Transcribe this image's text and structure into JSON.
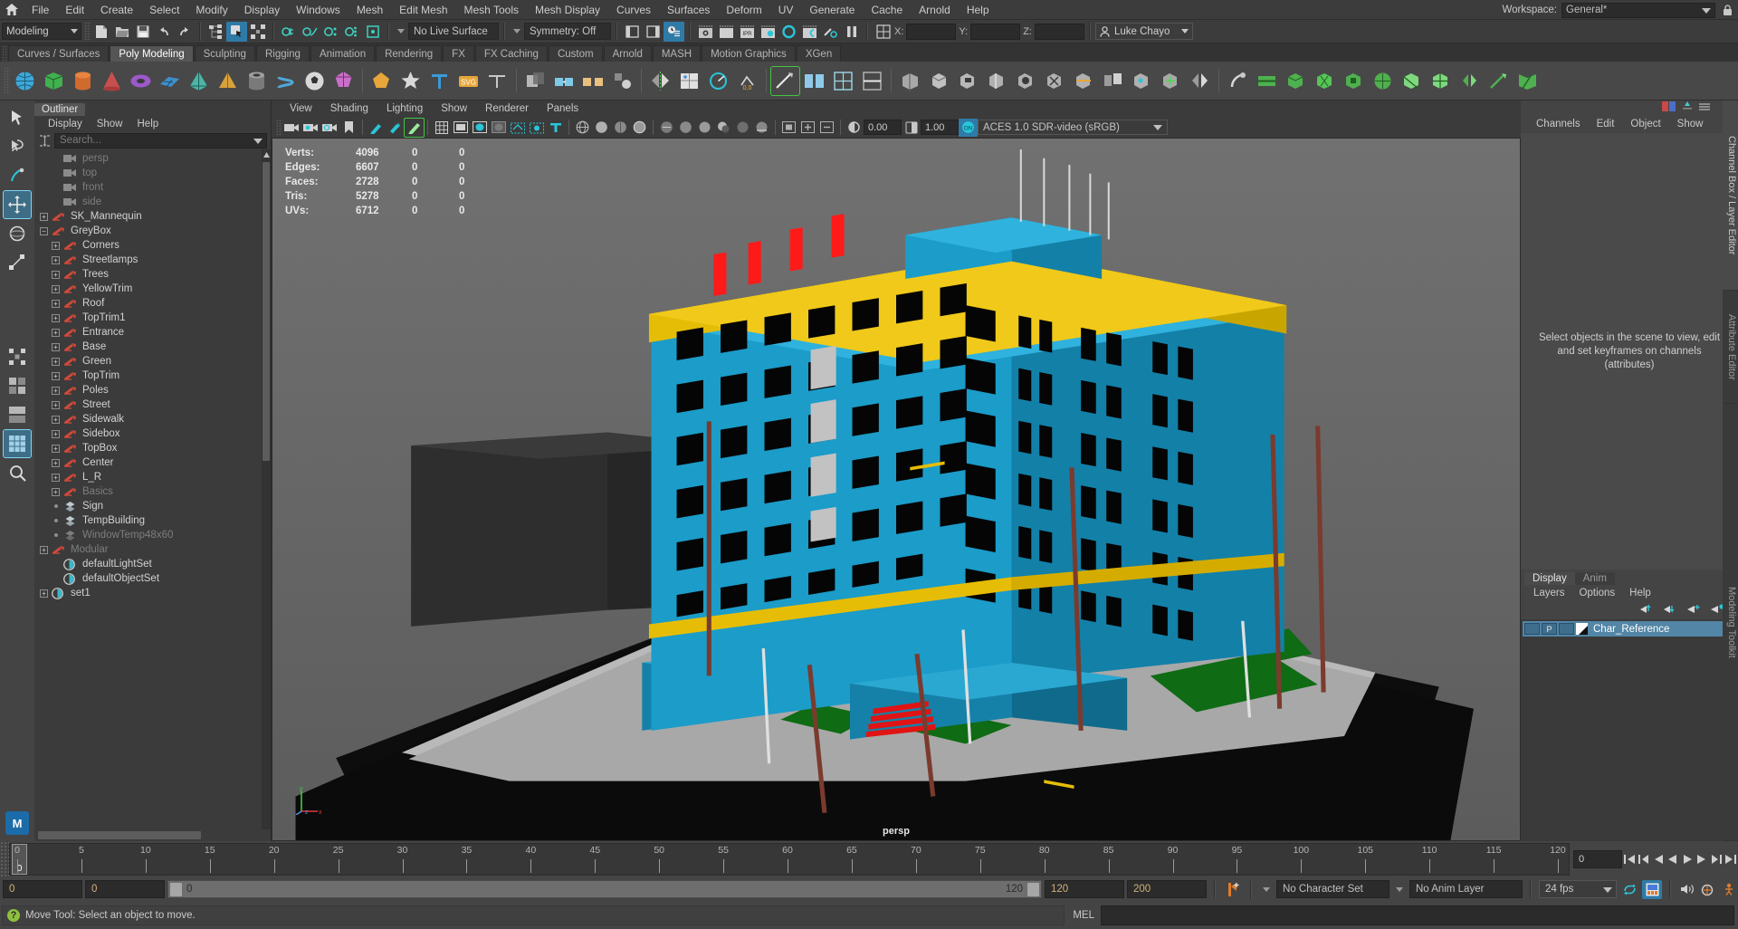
{
  "menubar": {
    "home_icon": "home-icon",
    "items": [
      "File",
      "Edit",
      "Create",
      "Select",
      "Modify",
      "Display",
      "Windows",
      "Mesh",
      "Edit Mesh",
      "Mesh Tools",
      "Mesh Display",
      "Curves",
      "Surfaces",
      "Deform",
      "UV",
      "Generate",
      "Cache",
      "Arnold",
      "Help"
    ],
    "workspace_label": "Workspace:",
    "workspace_value": "General*",
    "lock_icon": "lock-icon"
  },
  "statusline": {
    "mode": "Modeling",
    "live_surface": "No Live Surface",
    "symmetry": "Symmetry: Off",
    "coord_labels": [
      "X:",
      "Y:",
      "Z:"
    ],
    "coord_values": [
      "",
      "",
      ""
    ],
    "user": "Luke Chayo",
    "user_icon": "person-icon"
  },
  "shelf": {
    "tabs": [
      {
        "label": "Curves / Surfaces",
        "active": false
      },
      {
        "label": "Poly Modeling",
        "active": true
      },
      {
        "label": "Sculpting",
        "active": false
      },
      {
        "label": "Rigging",
        "active": false
      },
      {
        "label": "Animation",
        "active": false
      },
      {
        "label": "Rendering",
        "active": false
      },
      {
        "label": "FX",
        "active": false
      },
      {
        "label": "FX Caching",
        "active": false
      },
      {
        "label": "Custom",
        "active": false
      },
      {
        "label": "Arnold",
        "active": false
      },
      {
        "label": "MASH",
        "active": false
      },
      {
        "label": "Motion Graphics",
        "active": false
      },
      {
        "label": "XGen",
        "active": false
      }
    ]
  },
  "outliner": {
    "tab": "Outliner",
    "menus": [
      "Display",
      "Show",
      "Help"
    ],
    "search_placeholder": "Search...",
    "items": [
      {
        "label": "persp",
        "icon": "camera-icon",
        "indent": 1,
        "expander": "none",
        "dim": true
      },
      {
        "label": "top",
        "icon": "camera-icon",
        "indent": 1,
        "expander": "none",
        "dim": true
      },
      {
        "label": "front",
        "icon": "camera-icon",
        "indent": 1,
        "expander": "none",
        "dim": true
      },
      {
        "label": "side",
        "icon": "camera-icon",
        "indent": 1,
        "expander": "none",
        "dim": true
      },
      {
        "label": "SK_Mannequin",
        "icon": "transform-icon",
        "indent": 0,
        "expander": "plus",
        "dim": false
      },
      {
        "label": "GreyBox",
        "icon": "transform-icon",
        "indent": 0,
        "expander": "minus",
        "dim": false
      },
      {
        "label": "Corners",
        "icon": "transform-icon",
        "indent": 1,
        "expander": "plus",
        "dim": false
      },
      {
        "label": "Streetlamps",
        "icon": "transform-icon",
        "indent": 1,
        "expander": "plus",
        "dim": false
      },
      {
        "label": "Trees",
        "icon": "transform-icon",
        "indent": 1,
        "expander": "plus",
        "dim": false
      },
      {
        "label": "YellowTrim",
        "icon": "transform-icon",
        "indent": 1,
        "expander": "plus",
        "dim": false
      },
      {
        "label": "Roof",
        "icon": "transform-icon",
        "indent": 1,
        "expander": "plus",
        "dim": false
      },
      {
        "label": "TopTrim1",
        "icon": "transform-icon",
        "indent": 1,
        "expander": "plus",
        "dim": false
      },
      {
        "label": "Entrance",
        "icon": "transform-icon",
        "indent": 1,
        "expander": "plus",
        "dim": false
      },
      {
        "label": "Base",
        "icon": "transform-icon",
        "indent": 1,
        "expander": "plus",
        "dim": false
      },
      {
        "label": "Green",
        "icon": "transform-icon",
        "indent": 1,
        "expander": "plus",
        "dim": false
      },
      {
        "label": "TopTrim",
        "icon": "transform-icon",
        "indent": 1,
        "expander": "plus",
        "dim": false
      },
      {
        "label": "Poles",
        "icon": "transform-icon",
        "indent": 1,
        "expander": "plus",
        "dim": false
      },
      {
        "label": "Street",
        "icon": "transform-icon",
        "indent": 1,
        "expander": "plus",
        "dim": false
      },
      {
        "label": "Sidewalk",
        "icon": "transform-icon",
        "indent": 1,
        "expander": "plus",
        "dim": false
      },
      {
        "label": "Sidebox",
        "icon": "transform-icon",
        "indent": 1,
        "expander": "plus",
        "dim": false
      },
      {
        "label": "TopBox",
        "icon": "transform-icon",
        "indent": 1,
        "expander": "plus",
        "dim": false
      },
      {
        "label": "Center",
        "icon": "transform-icon",
        "indent": 1,
        "expander": "plus",
        "dim": false
      },
      {
        "label": "L_R",
        "icon": "transform-icon",
        "indent": 1,
        "expander": "plus",
        "dim": false
      },
      {
        "label": "Basics",
        "icon": "transform-icon",
        "indent": 1,
        "expander": "plus",
        "dim": true
      },
      {
        "label": "Sign",
        "icon": "mesh-icon",
        "indent": 1,
        "expander": "dot",
        "dim": false
      },
      {
        "label": "TempBuilding",
        "icon": "mesh-icon",
        "indent": 1,
        "expander": "dot",
        "dim": false
      },
      {
        "label": "WindowTemp48x60",
        "icon": "mesh-icon",
        "indent": 1,
        "expander": "dot",
        "dim": true
      },
      {
        "label": "Modular",
        "icon": "transform-icon",
        "indent": 0,
        "expander": "plus",
        "dim": true
      },
      {
        "label": "defaultLightSet",
        "icon": "set-icon",
        "indent": 1,
        "expander": "none",
        "dim": false
      },
      {
        "label": "defaultObjectSet",
        "icon": "set-icon",
        "indent": 1,
        "expander": "none",
        "dim": false
      },
      {
        "label": "set1",
        "icon": "set-icon",
        "indent": 0,
        "expander": "plus",
        "dim": false
      }
    ]
  },
  "viewport": {
    "menus": [
      "View",
      "Shading",
      "Lighting",
      "Show",
      "Renderer",
      "Panels"
    ],
    "hud": {
      "rows": [
        {
          "label": "Verts:",
          "v1": "4096",
          "v2": "0",
          "v3": "0"
        },
        {
          "label": "Edges:",
          "v1": "6607",
          "v2": "0",
          "v3": "0"
        },
        {
          "label": "Faces:",
          "v1": "2728",
          "v2": "0",
          "v3": "0"
        },
        {
          "label": "Tris:",
          "v1": "5278",
          "v2": "0",
          "v3": "0"
        },
        {
          "label": "UVs:",
          "v1": "6712",
          "v2": "0",
          "v3": "0"
        }
      ]
    },
    "exposure": "0.00",
    "gamma": "1.00",
    "color_management": "ACES 1.0 SDR-video (sRGB)",
    "camera_label": "persp",
    "axis_labels": [
      "y",
      "x",
      "z"
    ],
    "colors": {
      "bg_top": "#6e6e6e",
      "bg_bottom": "#5e5e5e",
      "building": "#1b9cc9",
      "building_dark": "#1581a8",
      "trim_yellow": "#e0b800",
      "accent_red": "#ff1a1a",
      "ground_black": "#0d0d0d",
      "sidewalk": "#b9b9b9",
      "grass": "#0f6b14",
      "pole_brown": "#7a3b2e",
      "greybox": "#333333"
    }
  },
  "rightpanel": {
    "menus": [
      "Channels",
      "Edit",
      "Object",
      "Show"
    ],
    "empty_message": "Select objects in the scene to view, edit and set keyframes on channels (attributes)",
    "vtabs": [
      "Channel Box / Layer Editor",
      "Attribute Editor",
      "Modeling Toolkit"
    ],
    "layers": {
      "tabs": [
        {
          "label": "Display",
          "active": true
        },
        {
          "label": "Anim",
          "active": false
        }
      ],
      "menus": [
        "Layers",
        "Options",
        "Help"
      ],
      "items": [
        {
          "chip1": "",
          "chip2": "P",
          "chip3": "",
          "name": "Char_Reference",
          "selected": true
        }
      ]
    }
  },
  "timeline": {
    "start_tick": 0,
    "end_tick": 120,
    "tick_step": 5,
    "tick_labels": [
      "0",
      "5",
      "10",
      "15",
      "20",
      "25",
      "30",
      "35",
      "40",
      "45",
      "50",
      "55",
      "60",
      "65",
      "70",
      "75",
      "80",
      "85",
      "90",
      "95",
      "100",
      "105",
      "110",
      "115",
      "120"
    ],
    "current_frame": "0",
    "range_start": "0",
    "range_current": "0",
    "range_min_label": "0",
    "range_max_label": "120",
    "anim_end": "120",
    "playback_end": "200",
    "character_set": "No Character Set",
    "anim_layer": "No Anim Layer",
    "fps": "24 fps"
  },
  "statusbar": {
    "help_text": "Move Tool: Select an object to move.",
    "mel_label": "MEL",
    "mel_value": ""
  }
}
